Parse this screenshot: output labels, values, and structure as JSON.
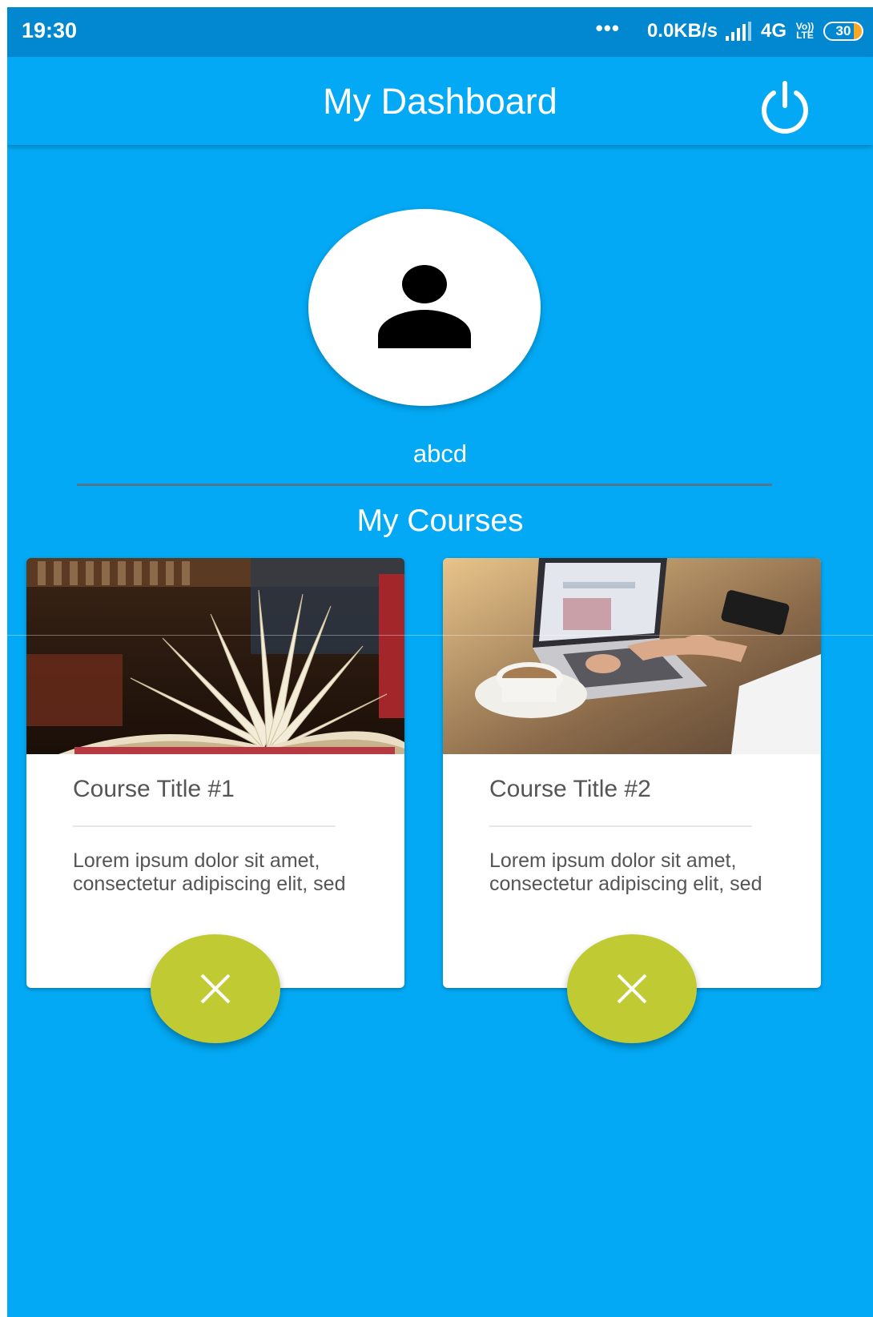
{
  "status_bar": {
    "time": "19:30",
    "dots": "•••",
    "speed": "0.0KB/s",
    "signal_icon": "signal-bars-icon",
    "network": "4G",
    "volte_top": "Vo))",
    "volte_bottom": "LTE",
    "battery_level": "30"
  },
  "app_bar": {
    "title": "My Dashboard",
    "power_icon": "power-icon"
  },
  "profile": {
    "avatar_icon": "person-icon",
    "username": "abcd"
  },
  "courses": {
    "heading": "My Courses",
    "items": [
      {
        "title": "Course Title #1",
        "description": "Lorem ipsum dolor sit amet, consectetur adipiscing elit, sed",
        "image": "open-book-photo",
        "action_icon": "close-icon"
      },
      {
        "title": "Course Title #2",
        "description": "Lorem ipsum dolor sit amet, consectetur adipiscing elit, sed",
        "image": "laptop-coffee-photo",
        "action_icon": "close-icon"
      }
    ]
  },
  "colors": {
    "primary": "#03a9f4",
    "status_bar": "#0288d1",
    "fab": "#c0ca33",
    "card": "#ffffff"
  }
}
